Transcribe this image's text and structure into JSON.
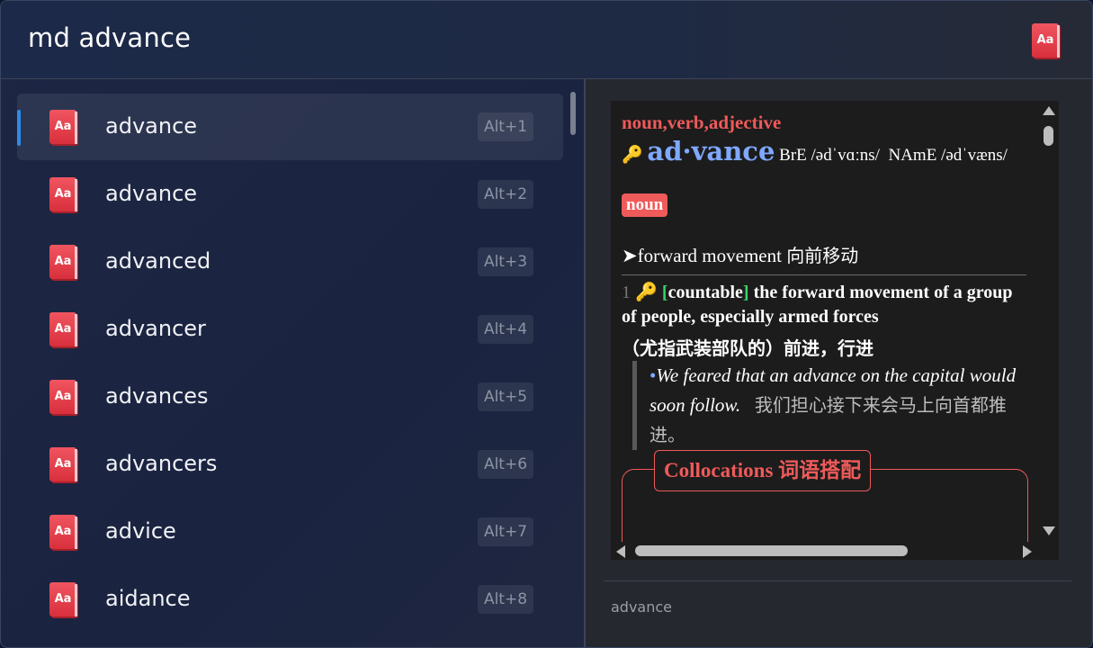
{
  "search": {
    "query": "md advance"
  },
  "header": {
    "icon": "dictionary-icon",
    "icon_text": "Aa"
  },
  "results": [
    {
      "word": "advance",
      "hotkey": "Alt+1",
      "icon_text": "Aa",
      "selected": true
    },
    {
      "word": "advance",
      "hotkey": "Alt+2",
      "icon_text": "Aa"
    },
    {
      "word": "advanced",
      "hotkey": "Alt+3",
      "icon_text": "Aa"
    },
    {
      "word": "advancer",
      "hotkey": "Alt+4",
      "icon_text": "Aa"
    },
    {
      "word": "advances",
      "hotkey": "Alt+5",
      "icon_text": "Aa"
    },
    {
      "word": "advancers",
      "hotkey": "Alt+6",
      "icon_text": "Aa"
    },
    {
      "word": "advice",
      "hotkey": "Alt+7",
      "icon_text": "Aa"
    },
    {
      "word": "aidance",
      "hotkey": "Alt+8",
      "icon_text": "Aa"
    }
  ],
  "preview": {
    "pos": "noun,verb,adjective",
    "key_icon": "🔑",
    "headword": "ad·vance",
    "pron_bre": "BrE /ədˈvɑːns/",
    "pron_name": "NAmE /ədˈvæns/",
    "badge": "noun",
    "sense_title": "➤forward movement",
    "sense_title_cn": "向前移动",
    "def_num": "1",
    "def_label": "countable",
    "def_text": "the forward movement of a group of people, especially armed forces",
    "def_cn": "（尤指武装部队的）前进，行进",
    "example_bullet": "•",
    "example_en": "We feared that an advance on the capital would soon follow.",
    "example_cn": "我们担心接下来会马上向首都推进。",
    "collocations_en": "Collocations",
    "collocations_cn": "词语搭配"
  },
  "footer": {
    "text": "advance"
  },
  "colors": {
    "accent": "#2b8ce8",
    "red": "#ef5a5a",
    "headword": "#7fa8ff",
    "label_green": "#3ad46a"
  }
}
